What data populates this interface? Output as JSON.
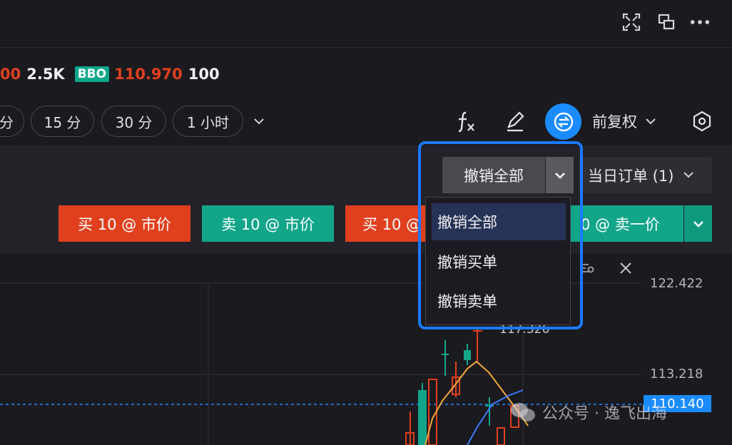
{
  "quote": {
    "last_size_prefix": "00",
    "volume": "2.5K",
    "bbo_label": "BBO",
    "bbo_price": "110.970",
    "bbo_size": "100"
  },
  "intervals": {
    "items": [
      "分",
      "15 分",
      "30 分",
      "1 小时"
    ],
    "more": "⌄"
  },
  "toolbar": {
    "adjust_label": "前复权"
  },
  "orders": {
    "cancel_all": "撤销全部",
    "today_orders": "当日订单 (1)"
  },
  "quick_trade": {
    "buy_market": "买 10 @ 市价",
    "sell_market": "卖 10 @ 市价",
    "buy_partial": "买 10 @",
    "sell_bid": "0 @ 卖一价"
  },
  "dropdown": {
    "items": [
      "撤销全部",
      "撤销买单",
      "撤销卖单"
    ],
    "selected_index": 0
  },
  "chart_axis": {
    "price_high": "122.422",
    "price_mid": "113.218",
    "price_current": "110.140",
    "annotation": "117.326"
  },
  "watermark": {
    "text": "公众号 · 逸飞出海"
  },
  "colors": {
    "up": "#e0401e",
    "down": "#12a58a",
    "accent": "#1a79ff",
    "current_price": "#1a8cff"
  }
}
